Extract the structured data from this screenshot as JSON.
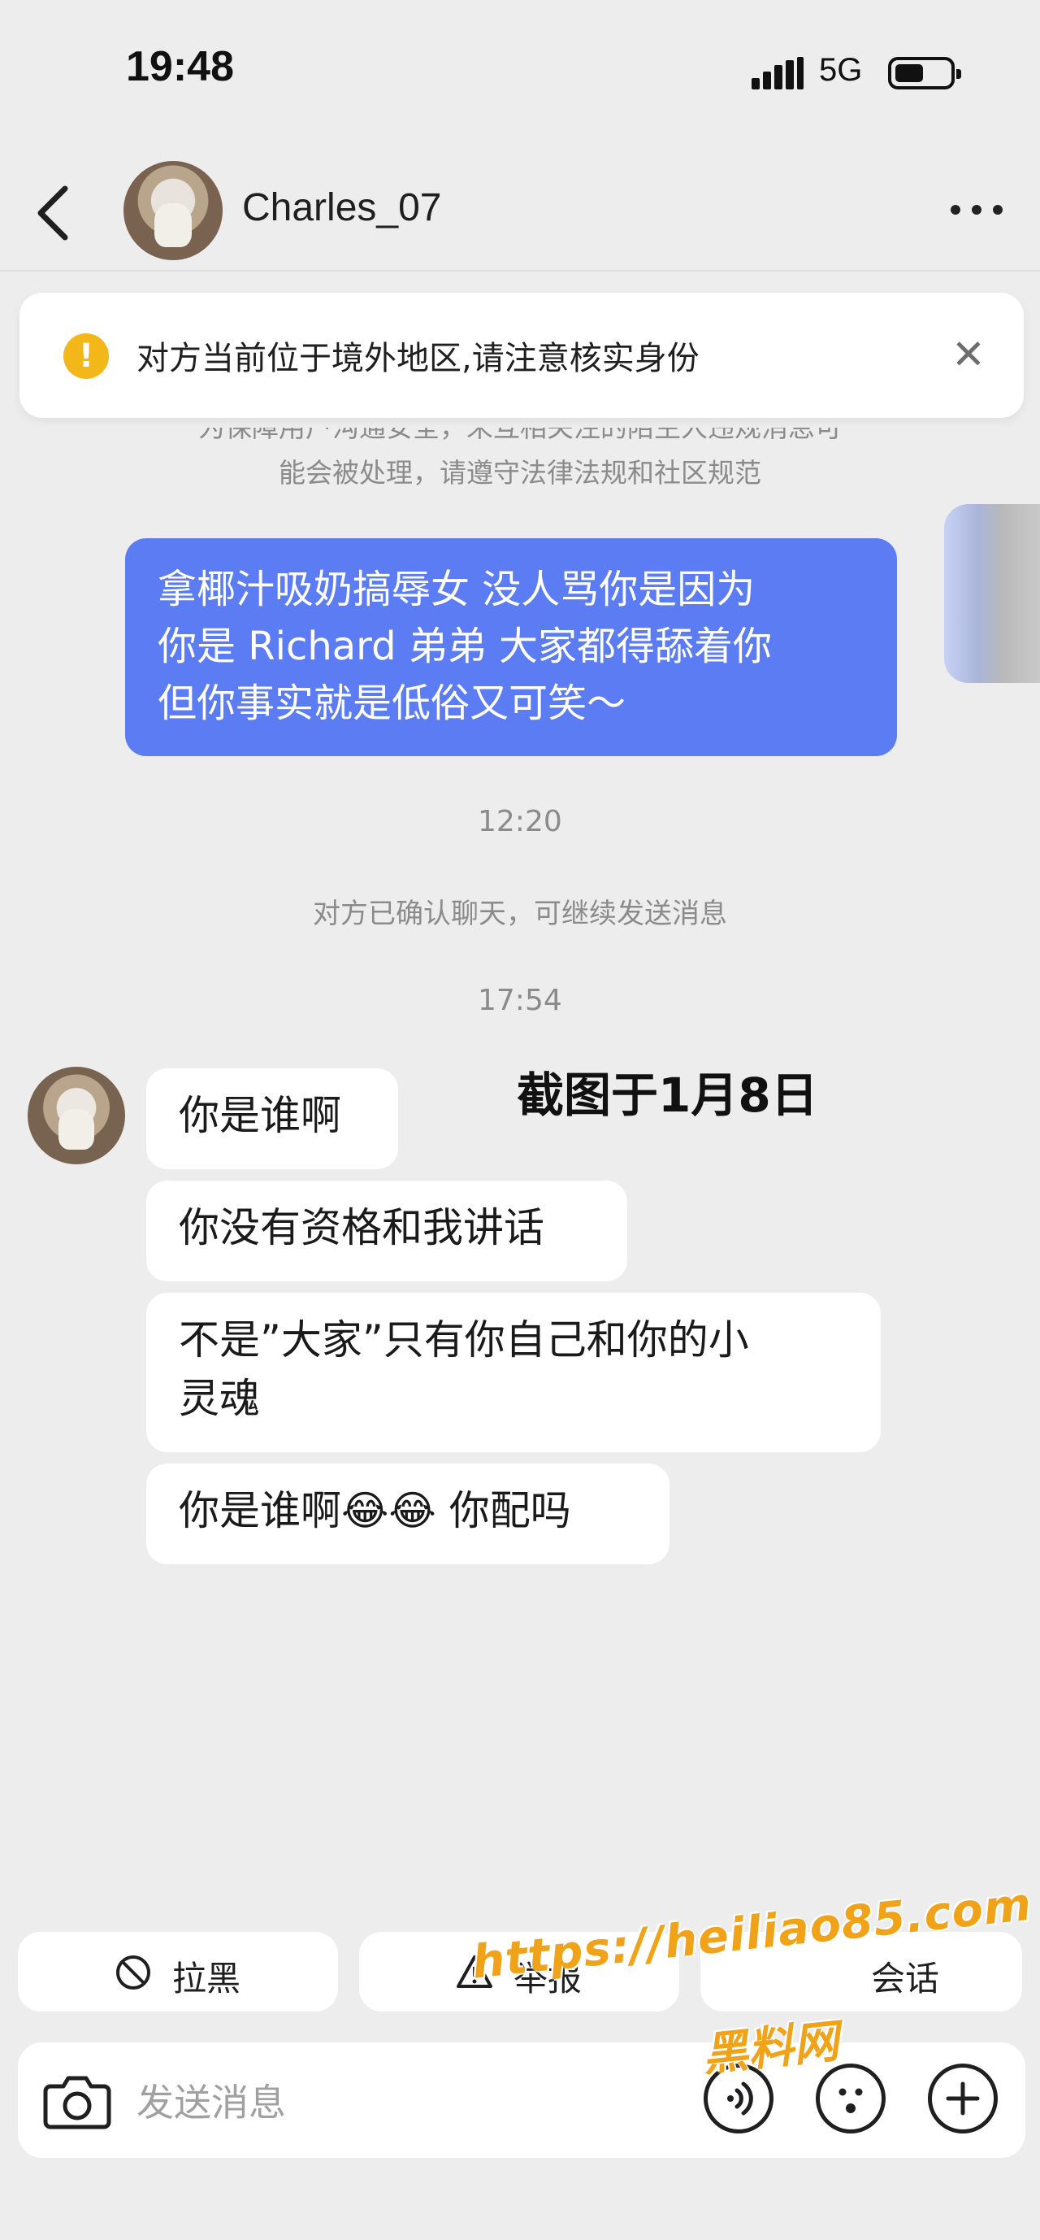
{
  "status_bar": {
    "time": "19:48",
    "network": "5G"
  },
  "header": {
    "username": "Charles_07"
  },
  "banner": {
    "text": "对方当前位于境外地区,请注意核实身份"
  },
  "system_note": {
    "line1": "为保障用户沟通安全，未互相关注的陌生人违规消息可",
    "line2": "能会被处理，请遵守法律法规和社区规范"
  },
  "outgoing_message": {
    "lines": [
      "拿椰汁吸奶搞辱女 没人骂你是因为",
      "你是 Richard 弟弟 大家都得舔着你",
      "但你事实就是低俗又可笑～"
    ]
  },
  "timestamps": {
    "first": "12:20",
    "second": "17:54"
  },
  "confirm_note": "对方已确认聊天，可继续发送消息",
  "overlay_caption": "截图于1月8日",
  "incoming_messages": [
    {
      "text": "你是谁啊"
    },
    {
      "text": "你没有资格和我讲话"
    },
    {
      "line1": "不是”大家”只有你自己和你的小",
      "line2": "灵魂"
    },
    {
      "text": "你是谁啊😂😂 你配吗"
    }
  ],
  "actions": {
    "block_label": "拉黑",
    "report_label": "举报",
    "third_label": "会话"
  },
  "input": {
    "placeholder": "发送消息"
  },
  "watermark": {
    "url": "https://heiliao85.com",
    "name": "黑料网"
  },
  "icons": [
    "back-arrow-icon",
    "more-dots-icon",
    "warning-icon",
    "close-icon",
    "block-icon",
    "report-warning-icon",
    "camera-icon",
    "voice-icon",
    "emoji-icon",
    "plus-icon"
  ],
  "colors": {
    "background": "#ededed",
    "outgoing_bubble": "#5b7cf2",
    "warning": "#f4b71a",
    "watermark": "#f0a318"
  }
}
